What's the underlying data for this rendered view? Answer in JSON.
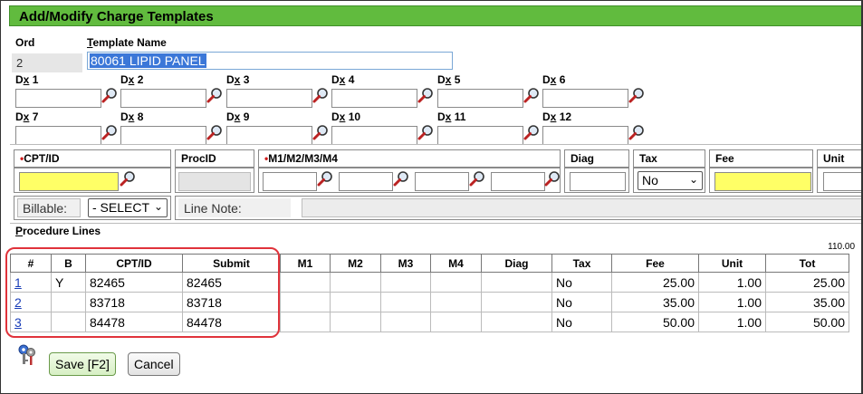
{
  "window": {
    "title": "Add/Modify Charge Templates"
  },
  "form": {
    "ord_label": "Ord",
    "ord_value": "2",
    "template_name_label": "Template Name",
    "template_name_value": "80061 LIPID PANEL"
  },
  "dx_fields": [
    {
      "label": "Dx 1"
    },
    {
      "label": "Dx 2"
    },
    {
      "label": "Dx 3"
    },
    {
      "label": "Dx 4"
    },
    {
      "label": "Dx 5"
    },
    {
      "label": "Dx 6"
    },
    {
      "label": "Dx 7"
    },
    {
      "label": "Dx 8"
    },
    {
      "label": "Dx 9"
    },
    {
      "label": "Dx 10"
    },
    {
      "label": "Dx 11"
    },
    {
      "label": "Dx 12"
    }
  ],
  "entry": {
    "cpt_label": "CPT/ID",
    "procid_label": "ProcID",
    "modifiers_label": "M1/M2/M3/M4",
    "diag_label": "Diag",
    "tax_label": "Tax",
    "tax_value": "No",
    "fee_label": "Fee",
    "unit_label": "Unit",
    "billable_label": "Billable:",
    "billable_value": "- SELECT",
    "line_note_label": "Line Note:"
  },
  "procedure_lines": {
    "section_label": "Procedure Lines",
    "total_display": "110.00",
    "columns": [
      "#",
      "B",
      "CPT/ID",
      "Submit",
      "M1",
      "M2",
      "M3",
      "M4",
      "Diag",
      "Tax",
      "Fee",
      "Unit",
      "Tot"
    ],
    "rows": [
      {
        "num": "1",
        "b": "Y",
        "cpt": "82465",
        "submit": "82465",
        "m1": "",
        "m2": "",
        "m3": "",
        "m4": "",
        "diag": "",
        "tax": "No",
        "fee": "25.00",
        "unit": "1.00",
        "tot": "25.00"
      },
      {
        "num": "2",
        "b": "",
        "cpt": "83718",
        "submit": "83718",
        "m1": "",
        "m2": "",
        "m3": "",
        "m4": "",
        "diag": "",
        "tax": "No",
        "fee": "35.00",
        "unit": "1.00",
        "tot": "35.00"
      },
      {
        "num": "3",
        "b": "",
        "cpt": "84478",
        "submit": "84478",
        "m1": "",
        "m2": "",
        "m3": "",
        "m4": "",
        "diag": "",
        "tax": "No",
        "fee": "50.00",
        "unit": "1.00",
        "tot": "50.00"
      }
    ]
  },
  "buttons": {
    "save": "Save [F2]",
    "cancel": "Cancel"
  },
  "icons": {
    "lookup": "magnifier-icon",
    "keys": "keys-icon"
  },
  "colors": {
    "title_bar": "#61bb3e",
    "highlight_field": "#ffff66",
    "annotation": "#e0333b",
    "link": "#1a3eb8"
  }
}
